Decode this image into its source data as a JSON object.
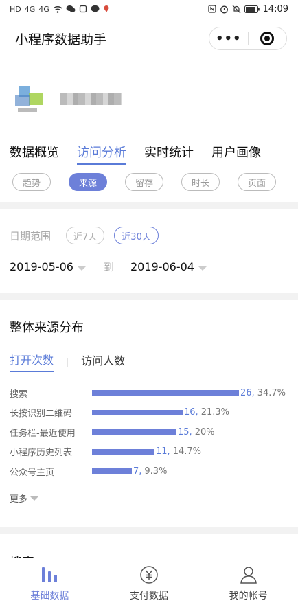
{
  "status_bar": {
    "time": "14:09",
    "left_glyphs": [
      "HD",
      "4G",
      "4G"
    ]
  },
  "header": {
    "title": "小程序数据助手"
  },
  "main_tabs": [
    {
      "label": "数据概览",
      "active": false
    },
    {
      "label": "访问分析",
      "active": true
    },
    {
      "label": "实时统计",
      "active": false
    },
    {
      "label": "用户画像",
      "active": false
    }
  ],
  "sub_tabs": [
    {
      "label": "趋势",
      "active": false
    },
    {
      "label": "来源",
      "active": true
    },
    {
      "label": "留存",
      "active": false
    },
    {
      "label": "时长",
      "active": false
    },
    {
      "label": "页面",
      "active": false
    }
  ],
  "date_range": {
    "label": "日期范围",
    "options": [
      {
        "label": "近7天",
        "active": false
      },
      {
        "label": "近30天",
        "active": true
      }
    ],
    "start": "2019-05-06",
    "to_label": "到",
    "end": "2019-06-04"
  },
  "distribution": {
    "title": "整体来源分布",
    "metric_tabs": [
      {
        "label": "打开次数",
        "active": true
      },
      {
        "label": "访问人数",
        "active": false
      }
    ],
    "metric_sep": "|",
    "more_label": "更多"
  },
  "chart_data": {
    "type": "bar",
    "orientation": "horizontal",
    "categories": [
      "搜索",
      "长按识别二维码",
      "任务栏-最近使用",
      "小程序历史列表",
      "公众号主页"
    ],
    "values": [
      26,
      16,
      15,
      11,
      7
    ],
    "value_labels": [
      "26,",
      "16,",
      "15,",
      "11,",
      "7,"
    ],
    "percent_labels": [
      "34.7%",
      "21.3%",
      "20%",
      "14.7%",
      "9.3%"
    ],
    "xlim": [
      0,
      26
    ],
    "grid": false,
    "bar_color": "#6d80d9"
  },
  "next_section": {
    "title": "搜索"
  },
  "bottom_nav": [
    {
      "label": "基础数据",
      "icon": "bar-chart-icon",
      "active": true
    },
    {
      "label": "支付数据",
      "icon": "yen-circle-icon",
      "active": false
    },
    {
      "label": "我的帐号",
      "icon": "user-icon",
      "active": false
    }
  ]
}
